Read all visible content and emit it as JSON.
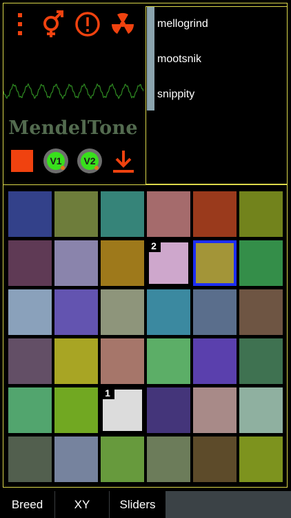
{
  "colors": {
    "accent": "#f0420f",
    "panel_border": "#dcd84a",
    "title": "#536b4f",
    "selection": "#1d2ef5",
    "knob_green": "#38e01c"
  },
  "toolbar": {
    "icons": [
      "menu-dots-icon",
      "gender-icon",
      "alert-icon",
      "radiation-icon"
    ]
  },
  "app": {
    "title": "MendelTone"
  },
  "controls": {
    "play_icon": "stop-square-icon",
    "knob1_label": "V1",
    "knob2_label": "V2",
    "download_icon": "download-arrow-icon"
  },
  "list": {
    "items": [
      {
        "label": "mellogrind"
      },
      {
        "label": "mootsnik"
      },
      {
        "label": "snippity"
      }
    ]
  },
  "grid": {
    "rows": [
      [
        {
          "color": "#33418a"
        },
        {
          "color": "#6e7d3b"
        },
        {
          "color": "#368479"
        },
        {
          "color": "#a56b6c"
        },
        {
          "color": "#9a3a1c"
        },
        {
          "color": "#72831c"
        }
      ],
      [
        {
          "color": "#5f3a55"
        },
        {
          "color": "#8a84ac"
        },
        {
          "color": "#9e791b"
        },
        {
          "color": "#cea7cc",
          "badge": "2"
        },
        {
          "color": "#a39538",
          "selected": true
        },
        {
          "color": "#348e49"
        }
      ],
      [
        {
          "color": "#8aa1bb"
        },
        {
          "color": "#6354b0"
        },
        {
          "color": "#8e957b"
        },
        {
          "color": "#3b89a0"
        },
        {
          "color": "#5a6e8c"
        },
        {
          "color": "#6e5543"
        }
      ],
      [
        {
          "color": "#634f66"
        },
        {
          "color": "#a8a524"
        },
        {
          "color": "#a6766a"
        },
        {
          "color": "#5cae67"
        },
        {
          "color": "#5a40ad"
        },
        {
          "color": "#3f7251"
        }
      ],
      [
        {
          "color": "#52a56e"
        },
        {
          "color": "#71a822"
        },
        {
          "color": "#dcdcdc",
          "badge": "1"
        },
        {
          "color": "#44357a"
        },
        {
          "color": "#a88a88"
        },
        {
          "color": "#8fb0a0"
        }
      ],
      [
        {
          "color": "#525f4e"
        },
        {
          "color": "#76839e"
        },
        {
          "color": "#679a3d"
        },
        {
          "color": "#6c7c5a"
        },
        {
          "color": "#5d4b2a"
        },
        {
          "color": "#7d931e"
        }
      ]
    ]
  },
  "tabs": [
    {
      "label": "Breed"
    },
    {
      "label": "XY"
    },
    {
      "label": "Sliders"
    }
  ]
}
